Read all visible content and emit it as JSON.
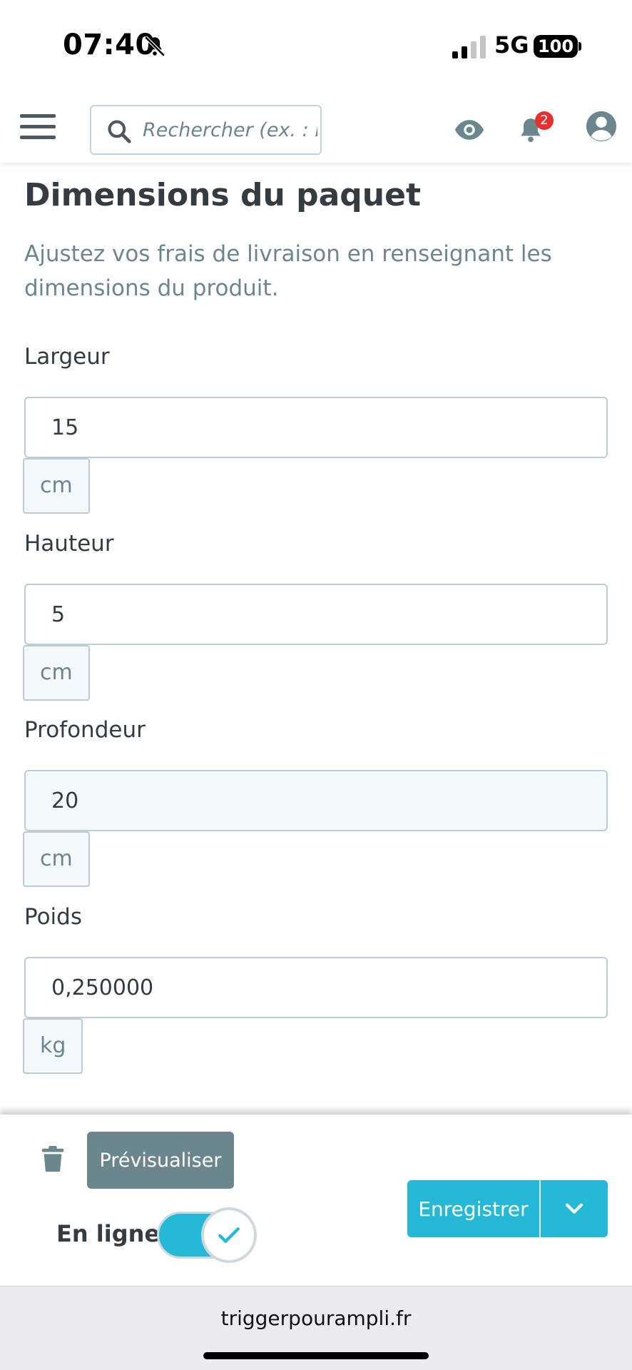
{
  "status_bar": {
    "time": "07:40",
    "network": "5G",
    "battery": "100"
  },
  "header": {
    "search_placeholder": "Rechercher (ex. : r",
    "notification_count": "2"
  },
  "section": {
    "title": "Dimensions du paquet",
    "description": "Ajustez vos frais de livraison en renseignant les dimensions du produit."
  },
  "fields": [
    {
      "label": "Largeur",
      "value": "15",
      "unit": "cm"
    },
    {
      "label": "Hauteur",
      "value": "5",
      "unit": "cm"
    },
    {
      "label": "Profondeur",
      "value": "20",
      "unit": "cm"
    },
    {
      "label": "Poids",
      "value": "0,250000",
      "unit": "kg"
    }
  ],
  "actions": {
    "preview_label": "Prévisualiser",
    "online_label": "En ligne",
    "online_enabled": true,
    "save_label": "Enregistrer"
  },
  "browser": {
    "url": "triggerpourampli.fr"
  },
  "colors": {
    "accent": "#25b9d7",
    "secondary_button": "#6c868e",
    "badge": "#e5312e",
    "text": "#363a41",
    "muted_text": "#6c868e"
  }
}
